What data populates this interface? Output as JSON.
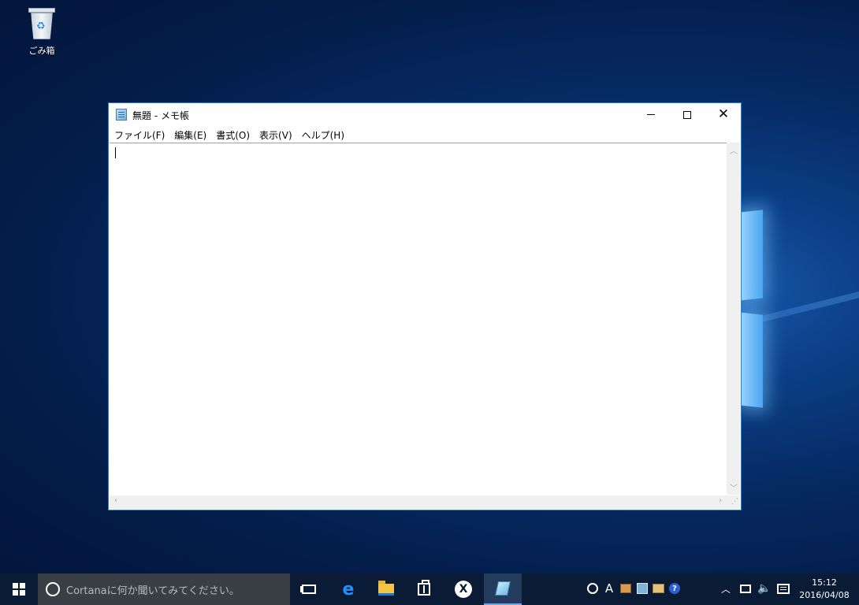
{
  "desktop": {
    "icons": [
      {
        "label": "ごみ箱",
        "icon": "recycle-bin-icon"
      }
    ]
  },
  "window": {
    "title": "無題 - メモ帳",
    "menu": [
      "ファイル(F)",
      "編集(E)",
      "書式(O)",
      "表示(V)",
      "ヘルプ(H)"
    ],
    "editor_text": ""
  },
  "taskbar": {
    "search_placeholder": "Cortanaに何か聞いてみてください。",
    "pinned": [
      "start-icon",
      "task-view-icon",
      "edge-icon",
      "file-explorer-icon",
      "store-icon",
      "xbox-icon",
      "notepad-icon"
    ],
    "tray": {
      "ime_label": "A",
      "time": "15:12",
      "date": "2016/04/08"
    }
  },
  "colors": {
    "accent": "#1883d7",
    "taskbar": "#0a1c35",
    "search_box": "#3a3f45"
  }
}
